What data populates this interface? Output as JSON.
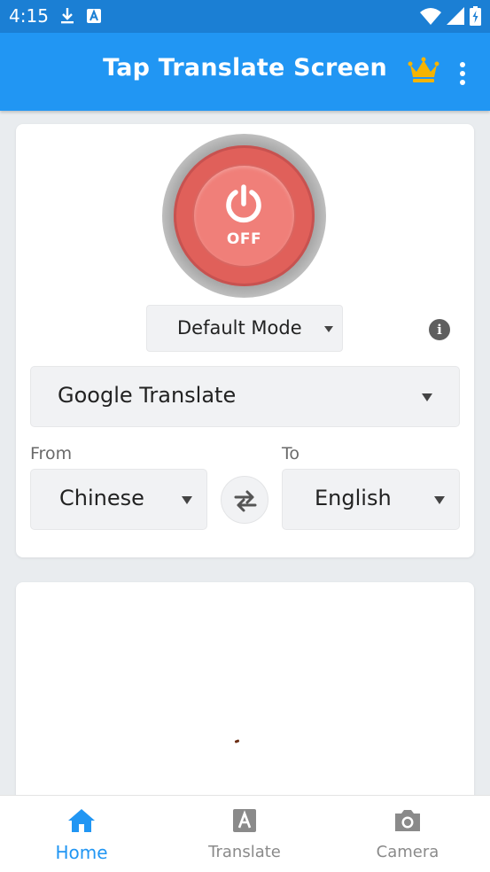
{
  "status_bar": {
    "time": "4:15",
    "icons_left": [
      "download-icon",
      "text-a-icon"
    ],
    "icons_right": [
      "wifi-icon",
      "signal-icon",
      "battery-charging-icon"
    ]
  },
  "app_bar": {
    "title": "Tap Translate Screen",
    "actions": [
      "crown-icon",
      "more-vert-icon"
    ]
  },
  "power": {
    "state_label": "OFF",
    "icon": "power-icon",
    "color": "#e0605a"
  },
  "mode": {
    "selected": "Default Mode",
    "info_glyph": "i"
  },
  "engine": {
    "selected": "Google Translate"
  },
  "languages": {
    "from_label": "From",
    "to_label": "To",
    "from_value": "Chinese",
    "to_value": "English",
    "swap_icon": "swap-horizontal-icon"
  },
  "bottom_nav": {
    "items": [
      {
        "label": "Home",
        "icon": "home-icon",
        "active": true
      },
      {
        "label": "Translate",
        "icon": "translate-icon",
        "active": false
      },
      {
        "label": "Camera",
        "icon": "camera-icon",
        "active": false
      }
    ]
  },
  "colors": {
    "status_bar": "#1b7fd4",
    "app_bar": "#2196f3",
    "accent": "#2196f3",
    "crown": "#f5b400"
  }
}
